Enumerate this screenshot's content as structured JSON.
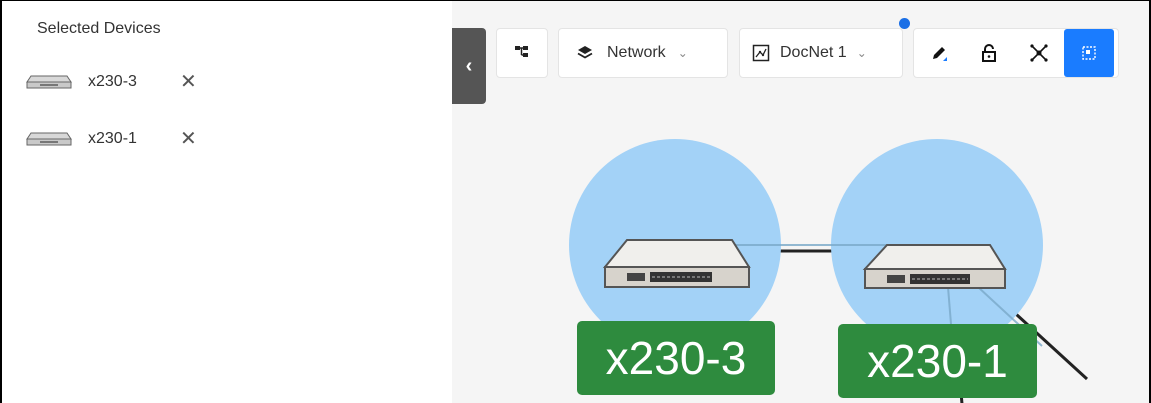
{
  "left_panel": {
    "title": "Selected Devices",
    "devices": [
      {
        "name": "x230-3",
        "remove_glyph": "✕",
        "icon": "switch-icon"
      },
      {
        "name": "x230-1",
        "remove_glyph": "✕",
        "icon": "switch-icon"
      }
    ]
  },
  "toolbar": {
    "collapse_glyph": "‹",
    "layer_select": {
      "label": "Network",
      "icon": "layers-icon"
    },
    "docnet_select": {
      "label": "DocNet 1",
      "icon": "map-icon"
    },
    "tools": [
      "pencil-icon",
      "lock-icon",
      "topology-icon",
      "select-region-icon"
    ],
    "active_tool": "select-region-icon",
    "notification_dot_color": "#1a6fe6"
  },
  "topology": {
    "nodes": [
      {
        "label": "x230-3"
      },
      {
        "label": "x230-1"
      }
    ],
    "node_halo_color": "#a3d2f7",
    "label_color": "#2e8b3e"
  }
}
